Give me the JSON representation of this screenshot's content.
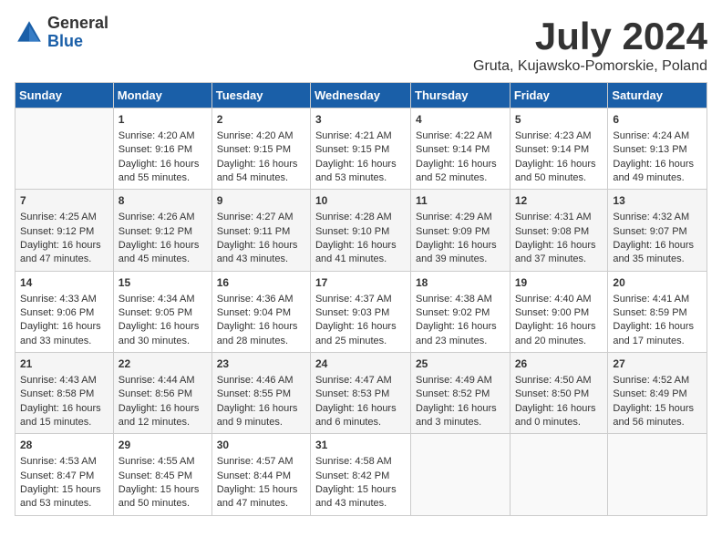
{
  "logo": {
    "general": "General",
    "blue": "Blue"
  },
  "title": "July 2024",
  "subtitle": "Gruta, Kujawsko-Pomorskie, Poland",
  "days_of_week": [
    "Sunday",
    "Monday",
    "Tuesday",
    "Wednesday",
    "Thursday",
    "Friday",
    "Saturday"
  ],
  "weeks": [
    [
      {
        "day": "",
        "content": ""
      },
      {
        "day": "1",
        "content": "Sunrise: 4:20 AM\nSunset: 9:16 PM\nDaylight: 16 hours\nand 55 minutes."
      },
      {
        "day": "2",
        "content": "Sunrise: 4:20 AM\nSunset: 9:15 PM\nDaylight: 16 hours\nand 54 minutes."
      },
      {
        "day": "3",
        "content": "Sunrise: 4:21 AM\nSunset: 9:15 PM\nDaylight: 16 hours\nand 53 minutes."
      },
      {
        "day": "4",
        "content": "Sunrise: 4:22 AM\nSunset: 9:14 PM\nDaylight: 16 hours\nand 52 minutes."
      },
      {
        "day": "5",
        "content": "Sunrise: 4:23 AM\nSunset: 9:14 PM\nDaylight: 16 hours\nand 50 minutes."
      },
      {
        "day": "6",
        "content": "Sunrise: 4:24 AM\nSunset: 9:13 PM\nDaylight: 16 hours\nand 49 minutes."
      }
    ],
    [
      {
        "day": "7",
        "content": "Sunrise: 4:25 AM\nSunset: 9:12 PM\nDaylight: 16 hours\nand 47 minutes."
      },
      {
        "day": "8",
        "content": "Sunrise: 4:26 AM\nSunset: 9:12 PM\nDaylight: 16 hours\nand 45 minutes."
      },
      {
        "day": "9",
        "content": "Sunrise: 4:27 AM\nSunset: 9:11 PM\nDaylight: 16 hours\nand 43 minutes."
      },
      {
        "day": "10",
        "content": "Sunrise: 4:28 AM\nSunset: 9:10 PM\nDaylight: 16 hours\nand 41 minutes."
      },
      {
        "day": "11",
        "content": "Sunrise: 4:29 AM\nSunset: 9:09 PM\nDaylight: 16 hours\nand 39 minutes."
      },
      {
        "day": "12",
        "content": "Sunrise: 4:31 AM\nSunset: 9:08 PM\nDaylight: 16 hours\nand 37 minutes."
      },
      {
        "day": "13",
        "content": "Sunrise: 4:32 AM\nSunset: 9:07 PM\nDaylight: 16 hours\nand 35 minutes."
      }
    ],
    [
      {
        "day": "14",
        "content": "Sunrise: 4:33 AM\nSunset: 9:06 PM\nDaylight: 16 hours\nand 33 minutes."
      },
      {
        "day": "15",
        "content": "Sunrise: 4:34 AM\nSunset: 9:05 PM\nDaylight: 16 hours\nand 30 minutes."
      },
      {
        "day": "16",
        "content": "Sunrise: 4:36 AM\nSunset: 9:04 PM\nDaylight: 16 hours\nand 28 minutes."
      },
      {
        "day": "17",
        "content": "Sunrise: 4:37 AM\nSunset: 9:03 PM\nDaylight: 16 hours\nand 25 minutes."
      },
      {
        "day": "18",
        "content": "Sunrise: 4:38 AM\nSunset: 9:02 PM\nDaylight: 16 hours\nand 23 minutes."
      },
      {
        "day": "19",
        "content": "Sunrise: 4:40 AM\nSunset: 9:00 PM\nDaylight: 16 hours\nand 20 minutes."
      },
      {
        "day": "20",
        "content": "Sunrise: 4:41 AM\nSunset: 8:59 PM\nDaylight: 16 hours\nand 17 minutes."
      }
    ],
    [
      {
        "day": "21",
        "content": "Sunrise: 4:43 AM\nSunset: 8:58 PM\nDaylight: 16 hours\nand 15 minutes."
      },
      {
        "day": "22",
        "content": "Sunrise: 4:44 AM\nSunset: 8:56 PM\nDaylight: 16 hours\nand 12 minutes."
      },
      {
        "day": "23",
        "content": "Sunrise: 4:46 AM\nSunset: 8:55 PM\nDaylight: 16 hours\nand 9 minutes."
      },
      {
        "day": "24",
        "content": "Sunrise: 4:47 AM\nSunset: 8:53 PM\nDaylight: 16 hours\nand 6 minutes."
      },
      {
        "day": "25",
        "content": "Sunrise: 4:49 AM\nSunset: 8:52 PM\nDaylight: 16 hours\nand 3 minutes."
      },
      {
        "day": "26",
        "content": "Sunrise: 4:50 AM\nSunset: 8:50 PM\nDaylight: 16 hours\nand 0 minutes."
      },
      {
        "day": "27",
        "content": "Sunrise: 4:52 AM\nSunset: 8:49 PM\nDaylight: 15 hours\nand 56 minutes."
      }
    ],
    [
      {
        "day": "28",
        "content": "Sunrise: 4:53 AM\nSunset: 8:47 PM\nDaylight: 15 hours\nand 53 minutes."
      },
      {
        "day": "29",
        "content": "Sunrise: 4:55 AM\nSunset: 8:45 PM\nDaylight: 15 hours\nand 50 minutes."
      },
      {
        "day": "30",
        "content": "Sunrise: 4:57 AM\nSunset: 8:44 PM\nDaylight: 15 hours\nand 47 minutes."
      },
      {
        "day": "31",
        "content": "Sunrise: 4:58 AM\nSunset: 8:42 PM\nDaylight: 15 hours\nand 43 minutes."
      },
      {
        "day": "",
        "content": ""
      },
      {
        "day": "",
        "content": ""
      },
      {
        "day": "",
        "content": ""
      }
    ]
  ]
}
